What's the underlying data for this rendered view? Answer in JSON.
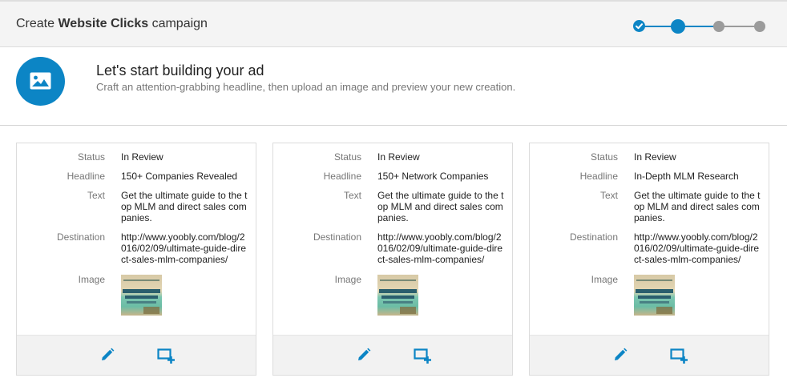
{
  "header": {
    "title_prefix": "Create",
    "title_bold": "Website Clicks",
    "title_suffix": "campaign",
    "steps": [
      "complete",
      "current",
      "upcoming",
      "upcoming"
    ]
  },
  "intro": {
    "icon": "image-icon",
    "title": "Let's start building your ad",
    "subtitle": "Craft an attention-grabbing headline, then upload an image and preview your new creation."
  },
  "labels": {
    "status": "Status",
    "headline": "Headline",
    "text": "Text",
    "destination": "Destination",
    "image": "Image"
  },
  "ads": [
    {
      "status": "In Review",
      "headline": "150+ Companies Revealed",
      "text": "Get the ultimate guide to the top MLM and direct sales companies.",
      "destination": "http://www.yoobly.com/blog/2016/02/09/ultimate-guide-direct-sales-mlm-companies/",
      "image_caption": "The Ultimate Guide to 150+ DIRECT SALES MLM COMPANIES"
    },
    {
      "status": "In Review",
      "headline": "150+ Network Companies",
      "text": "Get the ultimate guide to the top MLM and direct sales companies.",
      "destination": "http://www.yoobly.com/blog/2016/02/09/ultimate-guide-direct-sales-mlm-companies/",
      "image_caption": "The Ultimate Guide to 150+ DIRECT SALES MLM COMPANIES"
    },
    {
      "status": "In Review",
      "headline": "In-Depth MLM Research",
      "text": "Get the ultimate guide to the top MLM and direct sales companies.",
      "destination": "http://www.yoobly.com/blog/2016/02/09/ultimate-guide-direct-sales-mlm-companies/",
      "image_caption": "The Ultimate Guide to 150+ DIRECT SALES MLM COMPANIES"
    }
  ],
  "actions": {
    "edit_icon": "pencil-icon",
    "duplicate_icon": "duplicate-icon"
  },
  "colors": {
    "accent": "#0c85c5",
    "step_inactive": "#9b9b9b",
    "header_bg": "#f4f4f4",
    "card_footer_bg": "#f2f2f2"
  }
}
